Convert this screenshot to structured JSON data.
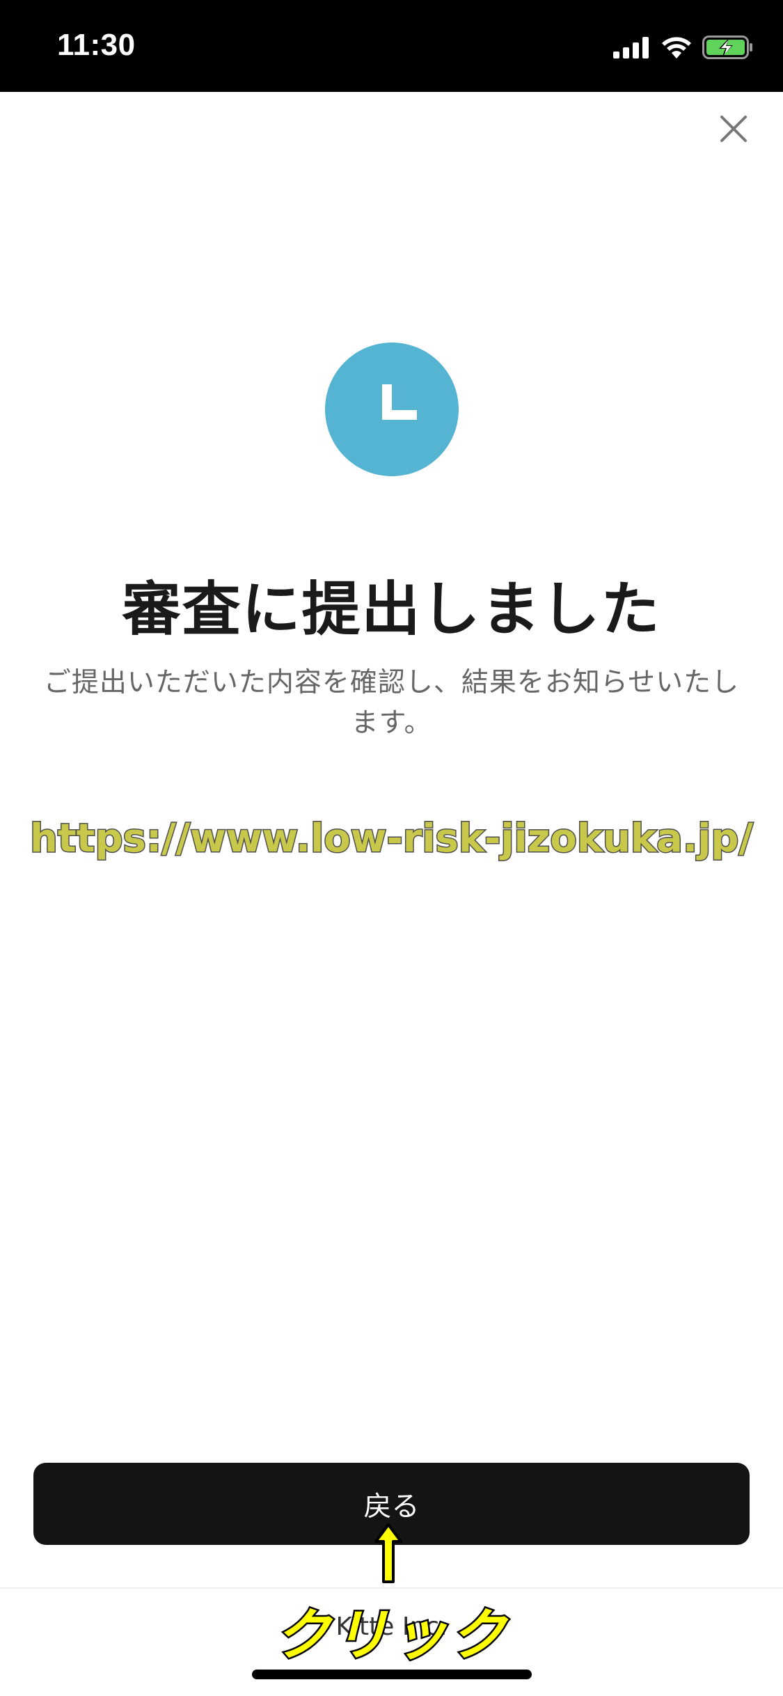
{
  "status_bar": {
    "time": "11:30",
    "icons": [
      "cellular-signal-icon",
      "wifi-icon",
      "battery-charging-icon"
    ],
    "battery_color": "#5fd35a"
  },
  "close": {
    "icon": "close-icon"
  },
  "status_icon": {
    "icon": "clock-icon",
    "color": "#54b4d2"
  },
  "title": "審査に提出しました",
  "description": "ご提出いただいた内容を確認し、結果をお知らせいたします。",
  "watermark_url": "https://www.low-risk-jizokuka.jp/",
  "back_button": {
    "label": "戻る"
  },
  "footer": {
    "text": "Kitte Inc."
  },
  "annotation": {
    "label": "クリック",
    "arrow": "up-arrow-icon",
    "color": "#ffff00"
  }
}
